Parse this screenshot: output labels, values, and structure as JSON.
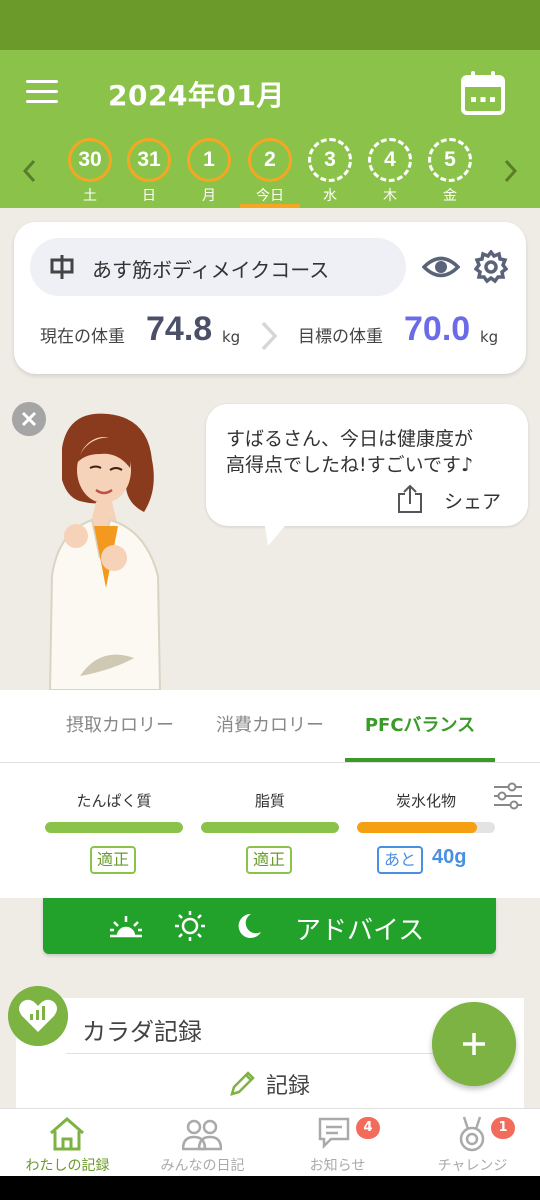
{
  "header": {
    "title": "2024年01月",
    "menu_icon": "hamburger-menu-icon",
    "calendar_icon": "calendar-icon"
  },
  "week": {
    "days": [
      {
        "num": "30",
        "label": "土",
        "state": "recorded"
      },
      {
        "num": "31",
        "label": "日",
        "state": "recorded"
      },
      {
        "num": "1",
        "label": "月",
        "state": "recorded"
      },
      {
        "num": "2",
        "label": "今日",
        "state": "today"
      },
      {
        "num": "3",
        "label": "水",
        "state": "future"
      },
      {
        "num": "4",
        "label": "木",
        "state": "future"
      },
      {
        "num": "5",
        "label": "金",
        "state": "future"
      }
    ]
  },
  "course": {
    "name": "あす筋ボディメイクコース",
    "current_label": "現在の体重",
    "current_value": "74.8",
    "target_label": "目標の体重",
    "target_value": "70.0",
    "unit": "kg"
  },
  "message": {
    "line1": "すばるさん、今日は健康度が",
    "line2": "高得点でしたね!すごいです♪",
    "share_label": "シェア"
  },
  "tabs": {
    "intake": "摂取カロリー",
    "burned": "消費カロリー",
    "pfc": "PFCバランス",
    "active": "pfc"
  },
  "pfc": {
    "protein": {
      "label": "たんぱく質",
      "fill": 1.0,
      "status": "適正",
      "color": "#8bc34a"
    },
    "fat": {
      "label": "脂質",
      "fill": 1.0,
      "status": "適正",
      "color": "#8bc34a"
    },
    "carbs": {
      "label": "炭水化物",
      "fill": 0.87,
      "status": "あと",
      "remaining": "40g",
      "color": "#f5a012"
    }
  },
  "advice": {
    "label": "アドバイス"
  },
  "body_record": {
    "title": "カラダ記録",
    "record_label": "記録"
  },
  "nav": {
    "my_record": "わたしの記録",
    "everyone_diary": "みんなの日記",
    "news": "お知らせ",
    "news_badge": "4",
    "challenge": "チャレンジ",
    "challenge_badge": "1"
  },
  "colors": {
    "header_green": "#8bc34a",
    "status_green": "#6c9a2a",
    "accent_orange": "#f5a623",
    "advice_green": "#22a22a",
    "target_purple": "#6b6be8"
  }
}
